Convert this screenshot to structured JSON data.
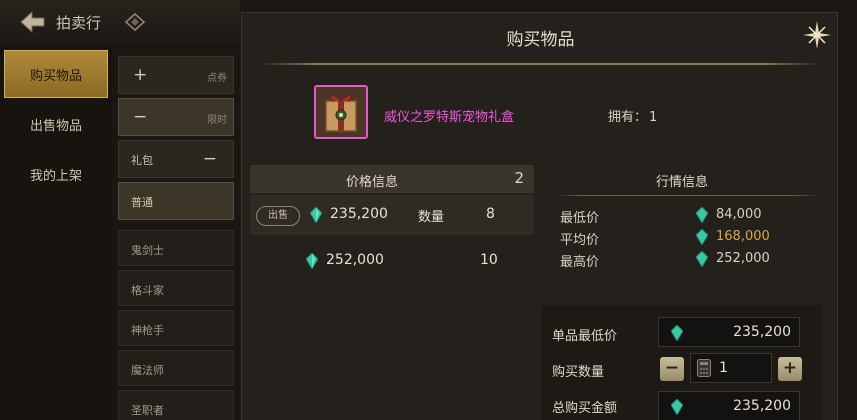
{
  "topbar": {
    "title": "拍卖行"
  },
  "left_tabs": [
    {
      "label": "购买物品",
      "active": true
    },
    {
      "label": "出售物品",
      "active": false
    },
    {
      "label": "我的上架",
      "active": false
    }
  ],
  "filters": {
    "item1_symbol": "+",
    "item1_label": "点券",
    "item2_symbol": "−",
    "item2_label": "限时",
    "category_label": "礼包",
    "category_symbol": "−",
    "selected_label": "普通"
  },
  "classes": [
    "鬼剑士",
    "格斗家",
    "神枪手",
    "魔法师",
    "圣职者"
  ],
  "dialog": {
    "title": "购买物品",
    "item_name": "威仪之罗特斯宠物礼盒",
    "owned_label": "拥有：",
    "owned_count": "1",
    "price_info": {
      "header": "价格信息",
      "count": "2",
      "sell_badge": "出售",
      "qty_label": "数量",
      "rows": [
        {
          "price": "235,200",
          "qty": "8"
        },
        {
          "price": "252,000",
          "qty": "10"
        }
      ]
    },
    "market_info": {
      "header": "行情信息",
      "lowest_label": "最低价",
      "lowest": "84,000",
      "avg_label": "平均价",
      "avg": "168,000",
      "highest_label": "最高价",
      "highest": "252,000"
    },
    "purchase": {
      "unit_min_label": "单品最低价",
      "unit_min": "235,200",
      "qty_label": "购买数量",
      "qty": "1",
      "minus": "−",
      "plus": "+",
      "total_label": "总购买金额",
      "total": "235,200"
    }
  },
  "colors": {
    "item_name": "#ee58dc",
    "avg_price": "#d4a94e",
    "tab_active": "#b08a38"
  }
}
